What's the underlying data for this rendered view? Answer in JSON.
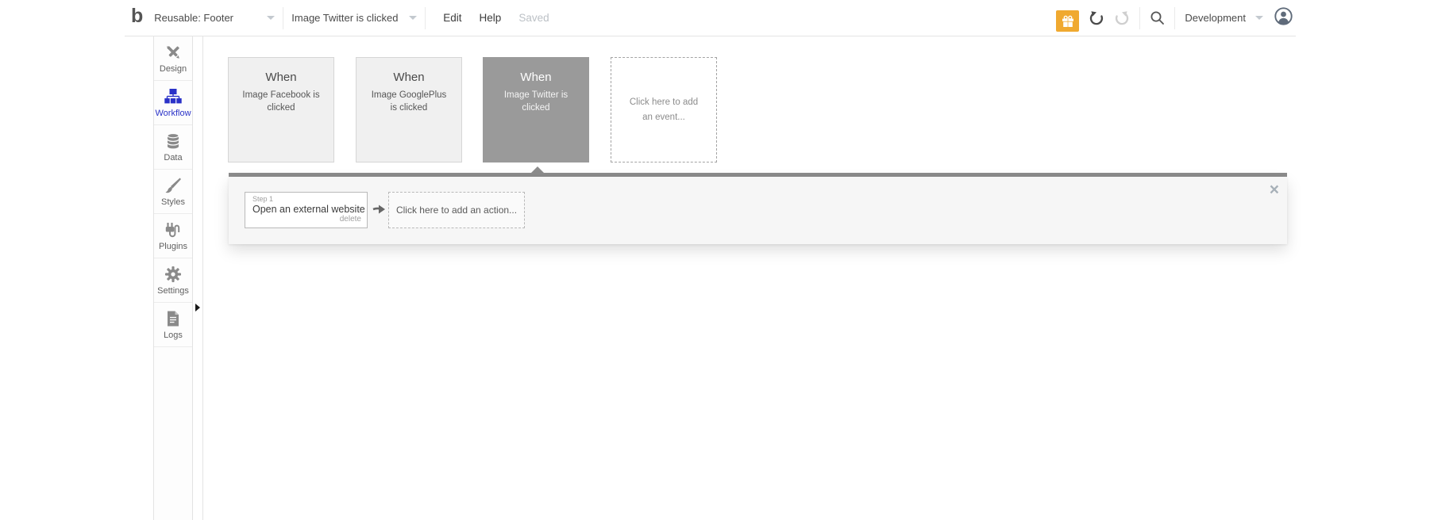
{
  "topbar": {
    "logo_glyph": "b",
    "page_dropdown": {
      "value": "Reusable: Footer"
    },
    "element_dropdown": {
      "value": "Image Twitter is clicked"
    },
    "menu": {
      "edit": "Edit",
      "help": "Help",
      "saved": "Saved"
    },
    "environment_dropdown": {
      "value": "Development"
    },
    "icons": {
      "gift": "gift-icon",
      "undo": "undo-icon",
      "redo": "redo-icon",
      "search": "search-icon",
      "avatar": "user-avatar-icon"
    },
    "colors": {
      "gift_bg": "#f0a930",
      "undo": "#4a4a4a",
      "redo": "#cfcfcf"
    }
  },
  "sidebar": {
    "items": [
      {
        "label": "Design",
        "icon": "design-icon",
        "active": false
      },
      {
        "label": "Workflow",
        "icon": "workflow-icon",
        "active": true
      },
      {
        "label": "Data",
        "icon": "data-icon",
        "active": false
      },
      {
        "label": "Styles",
        "icon": "styles-icon",
        "active": false
      },
      {
        "label": "Plugins",
        "icon": "plugins-icon",
        "active": false
      },
      {
        "label": "Settings",
        "icon": "settings-icon",
        "active": false
      },
      {
        "label": "Logs",
        "icon": "logs-icon",
        "active": false
      }
    ],
    "active_color": "#2a32c8"
  },
  "canvas": {
    "events": [
      {
        "title": "When",
        "subtitle": "Image Facebook is clicked",
        "selected": false
      },
      {
        "title": "When",
        "subtitle": "Image GooglePlus is clicked",
        "selected": false
      },
      {
        "title": "When",
        "subtitle": "Image Twitter is clicked",
        "selected": true
      }
    ],
    "add_event_placeholder": "Click here to add an event...",
    "action_panel": {
      "step": {
        "label": "Step 1",
        "action": "Open an external website",
        "delete_label": "delete"
      },
      "add_action_placeholder": "Click here to add an action...",
      "close_glyph": "×"
    },
    "colors": {
      "card_bg": "#f0f0f0",
      "selected_card_bg": "#9a9a9a",
      "panel_bar": "#8c8c8c"
    }
  }
}
